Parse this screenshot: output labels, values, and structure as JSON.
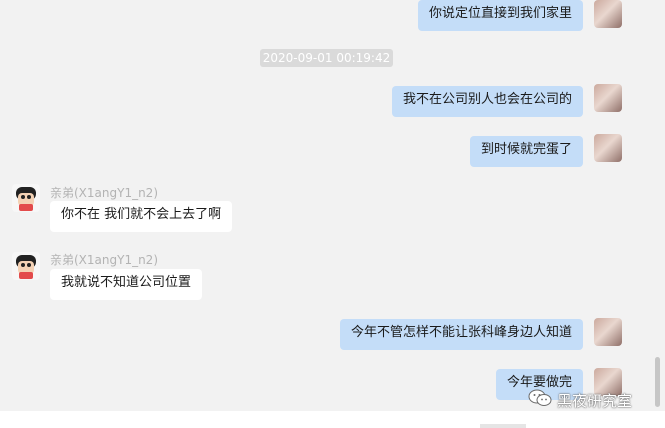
{
  "timestamp": "2020-09-01 00:19:42",
  "messages": [
    {
      "side": "me",
      "text": "你说定位直接到我们家里"
    },
    {
      "side": "me",
      "text": "我不在公司别人也会在公司的"
    },
    {
      "side": "me",
      "text": "到时候就完蛋了"
    },
    {
      "side": "them",
      "sender": "亲弟(X1angY1_n2)",
      "text": "你不在 我们就不会上去了啊"
    },
    {
      "side": "them",
      "sender": "亲弟(X1angY1_n2)",
      "text": "我就说不知道公司位置"
    },
    {
      "side": "me",
      "text": "今年不管怎样不能让张科峰身边人知道"
    },
    {
      "side": "me",
      "text": "今年要做完"
    }
  ],
  "watermark": {
    "text": "黑夜研究室",
    "icon": "wechat-icon"
  }
}
